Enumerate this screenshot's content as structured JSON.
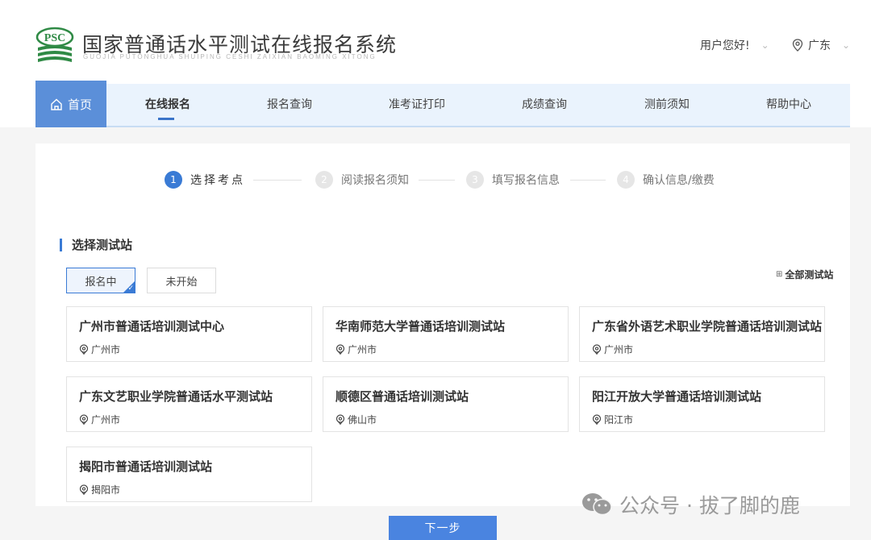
{
  "header": {
    "logo_text": "PSC",
    "title": "国家普通话水平测试在线报名系统",
    "subtitle": "GUOJIA PUTONGHUA SHUIPING CESHI ZAIXIAN BAOMING XITONG",
    "user_greeting": "用户您好!",
    "region": "广东"
  },
  "nav": {
    "home": "首页",
    "items": [
      "在线报名",
      "报名查询",
      "准考证打印",
      "成绩查询",
      "测前须知",
      "帮助中心"
    ],
    "active": "在线报名"
  },
  "steps": [
    {
      "num": "1",
      "label": "选择考点",
      "active": true
    },
    {
      "num": "2",
      "label": "阅读报名须知",
      "active": false
    },
    {
      "num": "3",
      "label": "填写报名信息",
      "active": false
    },
    {
      "num": "4",
      "label": "确认信息/缴费",
      "active": false
    }
  ],
  "section_title": "选择测试站",
  "filters": [
    {
      "label": "报名中",
      "selected": true
    },
    {
      "label": "未开始",
      "selected": false
    }
  ],
  "all_stations_label": "全部测试站",
  "stations": [
    {
      "name": "广州市普通话培训测试中心",
      "city": "广州市"
    },
    {
      "name": "华南师范大学普通话培训测试站",
      "city": "广州市"
    },
    {
      "name": "广东省外语艺术职业学院普通话培训测试站",
      "city": "广州市"
    },
    {
      "name": "广东文艺职业学院普通话水平测试站",
      "city": "广州市"
    },
    {
      "name": "顺德区普通话培训测试站",
      "city": "佛山市"
    },
    {
      "name": "阳江开放大学普通话培训测试站",
      "city": "阳江市"
    },
    {
      "name": "揭阳市普通话培训测试站",
      "city": "揭阳市"
    }
  ],
  "next_button": "下一步",
  "watermark": "公众号 · 拔了脚的鹿",
  "colors": {
    "accent": "#3a7bd5",
    "nav_bg": "#eaf3fd",
    "home_tab": "#5b8fd9",
    "button": "#4a84e0"
  }
}
